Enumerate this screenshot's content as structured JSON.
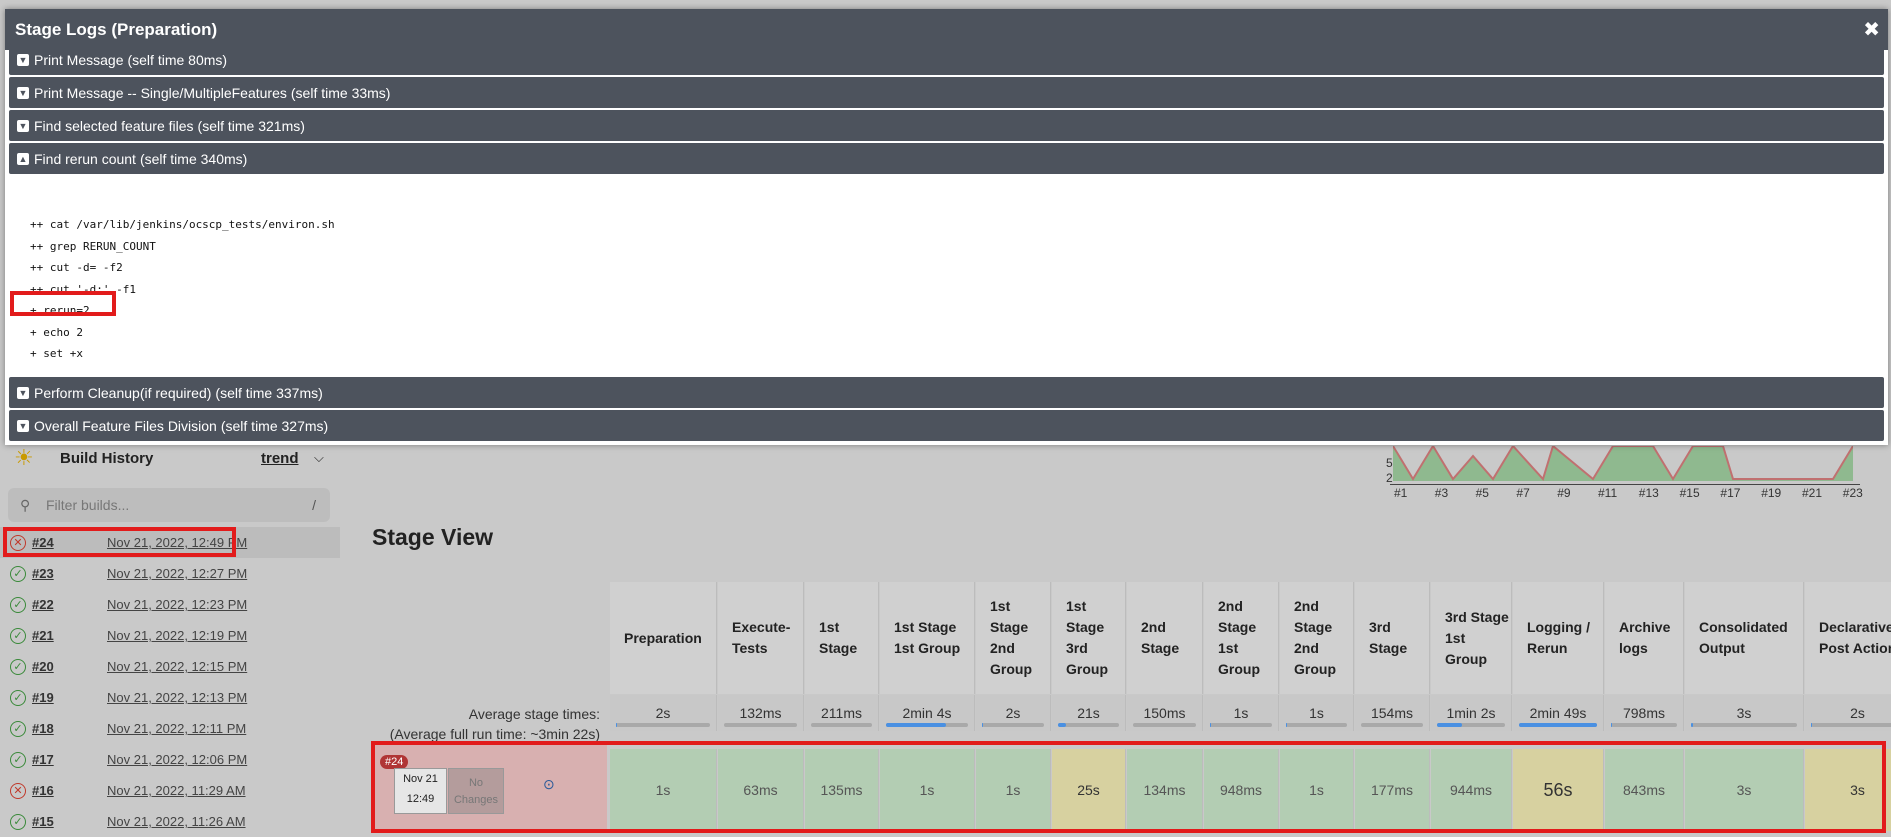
{
  "modal": {
    "title": "Stage Logs (Preparation)",
    "close_icon": "close-icon",
    "steps_top": [
      {
        "name": "Print Message",
        "time": "(self time 80ms)",
        "expanded": false
      },
      {
        "name": "Print Message -- Single/MultipleFeatures",
        "time": "(self time 33ms)",
        "expanded": false
      },
      {
        "name": "Find selected feature files",
        "time": "(self time 321ms)",
        "expanded": false
      },
      {
        "name": "Find rerun count",
        "time": "(self time 340ms)",
        "expanded": true
      }
    ],
    "log_lines": [
      "++ cat /var/lib/jenkins/ocscp_tests/environ.sh",
      "++ grep RERUN_COUNT",
      "++ cut -d= -f2",
      "++ cut '-d;' -f1",
      "+ rerun=2",
      "+ echo 2",
      "+ set +x"
    ],
    "steps_bottom": [
      {
        "name": "Perform Cleanup(if required)",
        "time": "(self time 337ms)",
        "expanded": false
      },
      {
        "name": "Overall Feature Files Division",
        "time": "(self time 327ms)",
        "expanded": false
      }
    ]
  },
  "build_history": {
    "title": "Build History",
    "trend_label": "trend",
    "filter_placeholder": "Filter builds...",
    "filter_shortcut": "/",
    "builds": [
      {
        "num": "#24",
        "date": "Nov 21, 2022, 12:49 PM",
        "status": "failed"
      },
      {
        "num": "#23",
        "date": "Nov 21, 2022, 12:27 PM",
        "status": "success"
      },
      {
        "num": "#22",
        "date": "Nov 21, 2022, 12:23 PM",
        "status": "success"
      },
      {
        "num": "#21",
        "date": "Nov 21, 2022, 12:19 PM",
        "status": "success"
      },
      {
        "num": "#20",
        "date": "Nov 21, 2022, 12:15 PM",
        "status": "success"
      },
      {
        "num": "#19",
        "date": "Nov 21, 2022, 12:13 PM",
        "status": "success"
      },
      {
        "num": "#18",
        "date": "Nov 21, 2022, 12:11 PM",
        "status": "success"
      },
      {
        "num": "#17",
        "date": "Nov 21, 2022, 12:06 PM",
        "status": "success"
      },
      {
        "num": "#16",
        "date": "Nov 21, 2022, 11:29 AM",
        "status": "failed"
      },
      {
        "num": "#15",
        "date": "Nov 21, 2022, 11:26 AM",
        "status": "success"
      }
    ]
  },
  "trend_chart": {
    "y_ticks": [
      "5",
      "2"
    ],
    "x_ticks": [
      "#1",
      "#3",
      "#5",
      "#7",
      "#9",
      "#11",
      "#13",
      "#15",
      "#17",
      "#19",
      "#21",
      "#23"
    ]
  },
  "stage_view": {
    "title": "Stage View",
    "avg_label": "Average stage times:",
    "avg_full": "(Average full run time: ~3min 22s)",
    "stages": [
      {
        "header": "Preparation",
        "avg": "2s",
        "run": "1s",
        "status": "success"
      },
      {
        "header": "Execute-Tests",
        "avg": "132ms",
        "run": "63ms",
        "status": "success"
      },
      {
        "header": "1st Stage",
        "avg": "211ms",
        "run": "135ms",
        "status": "success"
      },
      {
        "header": "1st Stage 1st Group",
        "avg": "2min 4s",
        "run": "1s",
        "status": "success"
      },
      {
        "header": "1st Stage 2nd Group",
        "avg": "2s",
        "run": "1s",
        "status": "success"
      },
      {
        "header": "1st Stage 3rd Group",
        "avg": "21s",
        "run": "25s",
        "status": "unstable"
      },
      {
        "header": "2nd Stage",
        "avg": "150ms",
        "run": "134ms",
        "status": "success"
      },
      {
        "header": "2nd Stage 1st Group",
        "avg": "1s",
        "run": "948ms",
        "status": "success"
      },
      {
        "header": "2nd Stage 2nd Group",
        "avg": "1s",
        "run": "1s",
        "status": "success"
      },
      {
        "header": "3rd Stage",
        "avg": "154ms",
        "run": "177ms",
        "status": "success"
      },
      {
        "header": "3rd Stage 1st Group",
        "avg": "1min 2s",
        "run": "944ms",
        "status": "success"
      },
      {
        "header": "Logging / Rerun",
        "avg": "2min 49s",
        "run": "56s",
        "status": "unstable"
      },
      {
        "header": "Archive logs",
        "avg": "798ms",
        "run": "843ms",
        "status": "success"
      },
      {
        "header": "Consolidated Output",
        "avg": "3s",
        "run": "3s",
        "status": "success"
      },
      {
        "header": "Declarative: Post Actions",
        "avg": "2s",
        "run": "3s",
        "status": "unstable"
      }
    ],
    "run": {
      "badge": "#24",
      "date": "Nov 21",
      "time": "12:49",
      "changes": "No Changes"
    }
  },
  "colors": {
    "header_bg": "#4d535d",
    "highlight": "#e21b1b",
    "success": "#b3cdb3",
    "unstable": "#d7d1a0"
  }
}
